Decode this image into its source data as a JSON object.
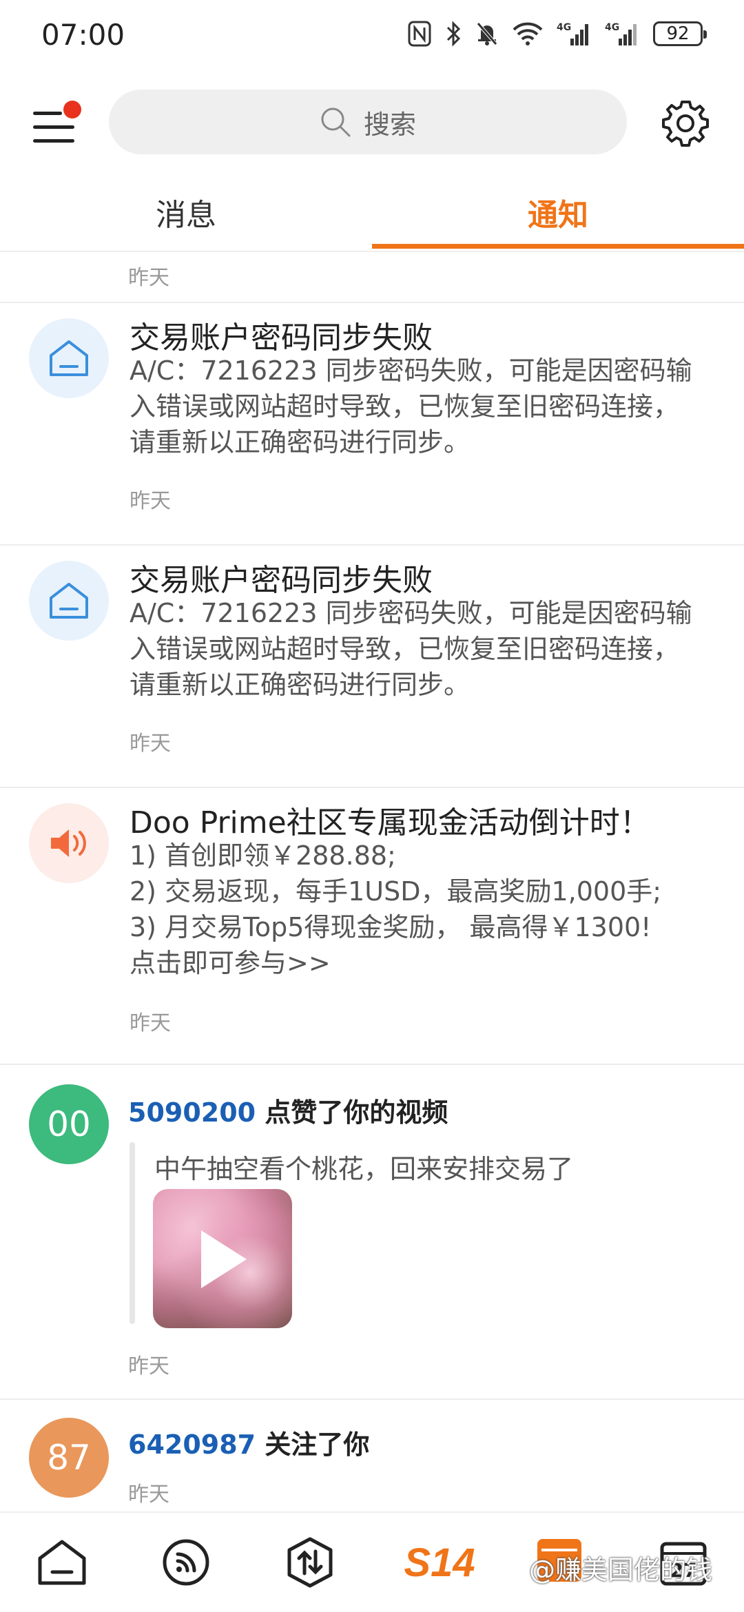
{
  "status_bar": {
    "time": "07:00",
    "battery": "92",
    "network_1": "4G",
    "network_2": "4G"
  },
  "header": {
    "search_placeholder": "搜索",
    "menu_has_badge": true
  },
  "tabs": [
    {
      "label": "消息",
      "active": false
    },
    {
      "label": "通知",
      "active": true
    }
  ],
  "feed": {
    "top_partial_time": "昨天",
    "items": [
      {
        "icon": "house-icon",
        "title": "交易账户密码同步失败",
        "body_lines": [
          "A/C：7216223 同步密码失败，可能是因密码输",
          "入错误或网站超时导致，已恢复至旧密码连接，",
          "请重新以正确密码进行同步。"
        ],
        "time": "昨天"
      },
      {
        "icon": "house-icon",
        "title": "交易账户密码同步失败",
        "body_lines": [
          "A/C：7216223 同步密码失败，可能是因密码输",
          "入错误或网站超时导致，已恢复至旧密码连接，",
          "请重新以正确密码进行同步。"
        ],
        "time": "昨天"
      },
      {
        "icon": "speaker-icon",
        "title": "Doo Prime社区专属现金活动倒计时！",
        "body_lines": [
          "1) 首创即领￥288.88;",
          "2) 交易返现，每手1USD，最高奖励1,000手;",
          "3) 月交易Top5得现金奖励， 最高得￥1300!",
          "点击即可参与>>"
        ],
        "time": "昨天"
      },
      {
        "avatar_text": "00",
        "avatar_color": "#3dba7d",
        "user_id": "5090200",
        "action": " 点赞了你的视频",
        "quote": "中午抽空看个桃花，回来安排交易了",
        "has_video": true,
        "time": "昨天"
      },
      {
        "avatar_text": "87",
        "avatar_color": "#e9975a",
        "user_id": "6420987",
        "action": " 关注了你",
        "time": "昨天"
      }
    ]
  },
  "bottom_nav": {
    "items": [
      "home-icon",
      "feed-icon",
      "trade-icon",
      "s14",
      "live-icon",
      "calendar-icon"
    ],
    "s14_label": "S14",
    "calendar_day": "27"
  },
  "watermark": "@赚美国佬的钱",
  "colors": {
    "accent": "#f07418",
    "user_link": "#1a5fb4",
    "badge_red": "#e8321e"
  }
}
